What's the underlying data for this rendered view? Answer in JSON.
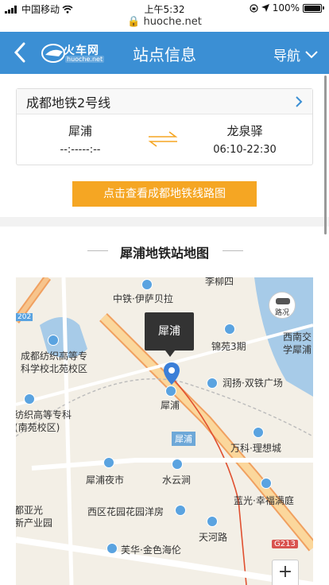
{
  "status": {
    "carrier": "中国移动",
    "time": "上午5:32",
    "url": "huoche.net",
    "battery": "100%"
  },
  "header": {
    "logo_text": "火车网",
    "logo_sub": "huoche.net",
    "title": "站点信息",
    "nav_label": "导航"
  },
  "line": {
    "name": "成都地铁2号线",
    "from_station": "犀浦",
    "from_time": "--:-----:--",
    "to_station": "龙泉驿",
    "to_time": "06:10-22:30",
    "map_button": "点击查看成都地铁线路图"
  },
  "map_section": {
    "title": "犀浦地铁站地图",
    "tooltip": "犀浦",
    "labels": {
      "l1": "李柳四",
      "l2": "中铁·伊萨贝拉",
      "l3": "西南交",
      "l4": "学犀浦",
      "l5": "锦苑3期",
      "l6": "成都纺织高等专",
      "l7": "科学校北苑校区",
      "l8": "润扬·双铁广场",
      "l9": "犀浦",
      "l10": "纺织高等专科",
      "l11": "(南苑校区)",
      "l12": "万科·理想城",
      "l13": "犀浦夜市",
      "l14": "水云涧",
      "l15": "蓝光·幸福满庭",
      "l16": "都亚光",
      "l17": "新产业园",
      "l18": "西区花园花园洋房",
      "l19": "天河路",
      "l20": "芙华·金色海伦"
    },
    "road_tag": "犀浦",
    "g_tag": "G213",
    "num_tag": "202",
    "traffic_label": "路况",
    "zoom_label": "+"
  }
}
